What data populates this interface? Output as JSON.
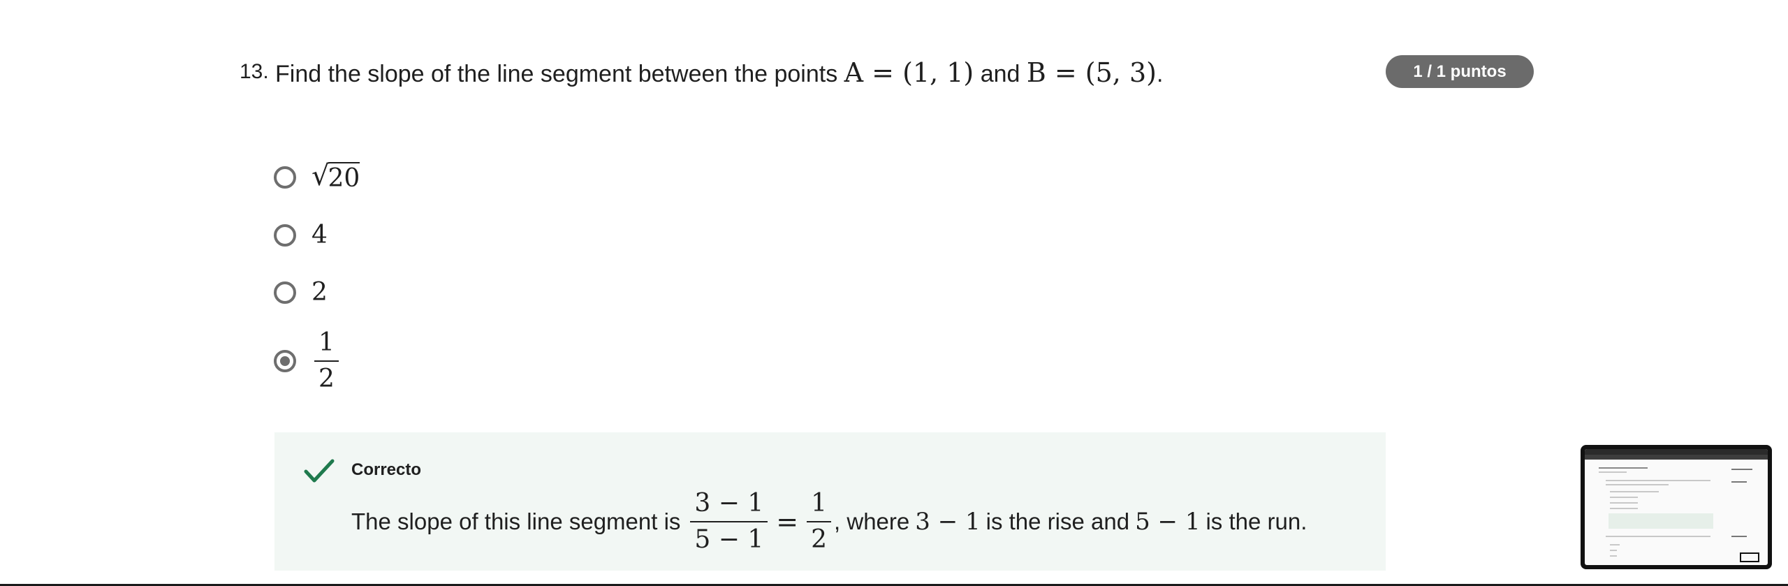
{
  "question": {
    "number": "13.",
    "text_before": "Find the slope of the line segment between the points ",
    "point_a": "A = (1, 1)",
    "text_and": " and ",
    "point_b": "B = (5, 3)",
    "text_end": ".",
    "score": "1 / 1 puntos"
  },
  "options": [
    {
      "label": "20",
      "kind": "sqrt",
      "selected": false
    },
    {
      "label": "4",
      "kind": "number",
      "selected": false
    },
    {
      "label": "2",
      "kind": "number",
      "selected": false
    },
    {
      "num": "1",
      "den": "2",
      "kind": "fraction",
      "selected": true
    }
  ],
  "feedback": {
    "title": "Correcto",
    "text_before": "The slope of this line segment is",
    "frac1_num": "3 − 1",
    "frac1_den": "5 − 1",
    "equals": "=",
    "frac2_num": "1",
    "frac2_den": "2",
    "text_mid": ", where",
    "rise_expr": "3 − 1",
    "text_rise": "is the rise and",
    "run_expr": "5 − 1",
    "text_run": "is the run.",
    "accent_color": "#1f7a4d"
  },
  "colors": {
    "score_pill": "#6b6b6b",
    "feedback_bg": "#f2f7f4",
    "radio": "#6e6e6e"
  }
}
